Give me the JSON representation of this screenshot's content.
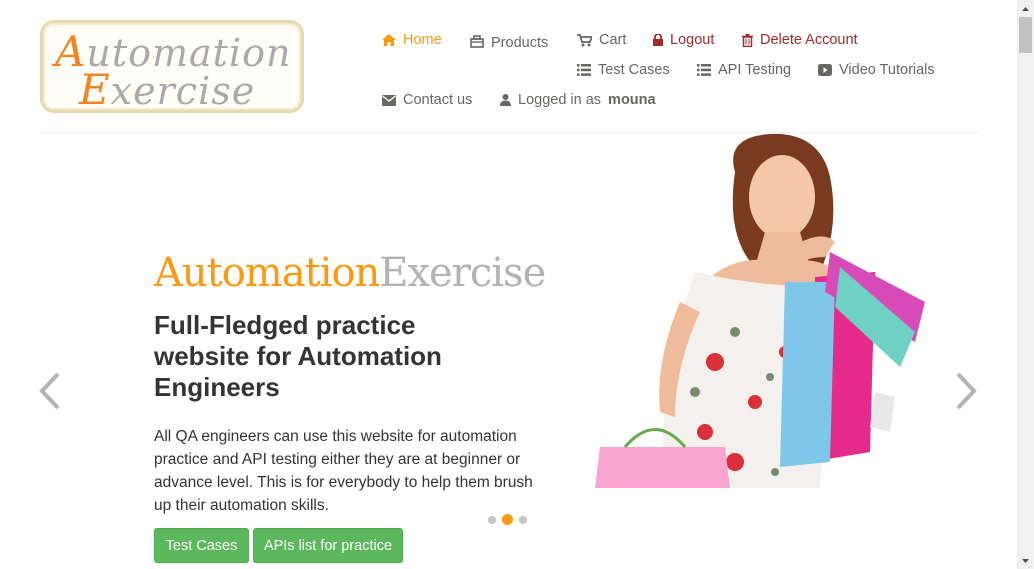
{
  "logo": {
    "line1_cap": "A",
    "line1_rest": "utomation",
    "line2_cap": "E",
    "line2_rest": "xercise"
  },
  "nav": {
    "home": "Home",
    "products": "Products",
    "cart": "Cart",
    "logout": "Logout",
    "delete_account": "Delete Account",
    "test_cases": "Test Cases",
    "api_testing": "API Testing",
    "video_tutorials": "Video Tutorials",
    "contact_us": "Contact us",
    "logged_in_prefix": "Logged in as",
    "username": "mouna"
  },
  "slider": {
    "brand_a": "Automation",
    "brand_b": "Exercise",
    "headline": "Full-Fledged practice website for Automation Engineers",
    "description": "All QA engineers can use this website for automation practice and API testing either they are at beginner or advance level. This is for everybody to help them brush up their automation skills.",
    "btn_test_cases": "Test Cases",
    "btn_apis": "APIs list for practice",
    "active_slide": 2,
    "slide_count": 3
  },
  "icons": {
    "home": "home-icon",
    "products": "products-icon",
    "cart": "cart-icon",
    "logout": "lock-icon",
    "delete": "trash-icon",
    "list": "list-icon",
    "video": "youtube-play-icon",
    "contact": "envelope-icon",
    "user": "user-icon"
  },
  "colors": {
    "accent": "#fe980f",
    "danger": "#a52a2a",
    "button": "#5cb85c",
    "text": "#696763"
  }
}
